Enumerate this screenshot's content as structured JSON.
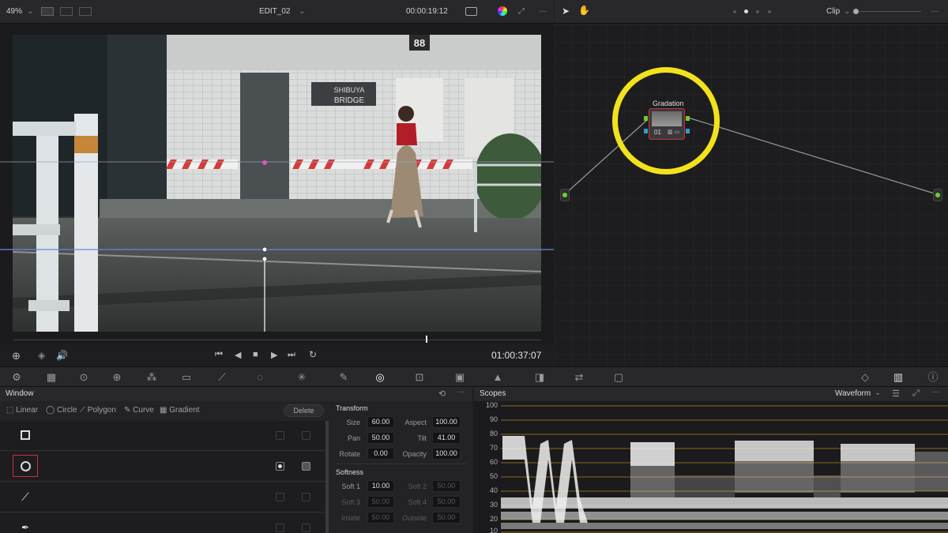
{
  "viewer": {
    "zoom": "49%",
    "clip_name": "EDIT_02",
    "timecode_top": "00:00:19:12",
    "timecode_bottom": "01:00:37:07"
  },
  "scene": {
    "sign_number": "88",
    "sign_line1": "SHIBUYA",
    "sign_line2": "BRIDGE"
  },
  "node_editor": {
    "mode": "Clip",
    "node_label": "Gradation",
    "node_number": "01",
    "highlight_color": "#f2e21b"
  },
  "window_panel": {
    "title": "Window",
    "shapes": [
      "Linear",
      "Circle",
      "Polygon",
      "Curve",
      "Gradient"
    ],
    "delete_label": "Delete",
    "transform_title": "Transform",
    "transform": {
      "size_label": "Size",
      "size": "60.00",
      "aspect_label": "Aspect",
      "aspect": "100.00",
      "pan_label": "Pan",
      "pan": "50.00",
      "tilt_label": "Tilt",
      "tilt": "41.00",
      "rotate_label": "Rotate",
      "rotate": "0.00",
      "opacity_label": "Opacity",
      "opacity": "100.00"
    },
    "softness_title": "Softness",
    "softness": {
      "soft1_label": "Soft 1",
      "soft1": "10.00",
      "soft2_label": "Soft 2",
      "soft2": "50.00",
      "soft3_label": "Soft 3",
      "soft3": "50.00",
      "soft4_label": "Soft 4",
      "soft4": "50.00",
      "inside_label": "Inside",
      "inside": "50.00",
      "outside_label": "Outside",
      "outside": "50.00"
    }
  },
  "scopes": {
    "title": "Scopes",
    "mode": "Waveform",
    "scale": [
      "100",
      "90",
      "80",
      "70",
      "60",
      "50",
      "40",
      "30",
      "20",
      "10"
    ]
  },
  "colors": {
    "accent_red": "#c83232",
    "waveform_grid": "#8a6a1a"
  }
}
